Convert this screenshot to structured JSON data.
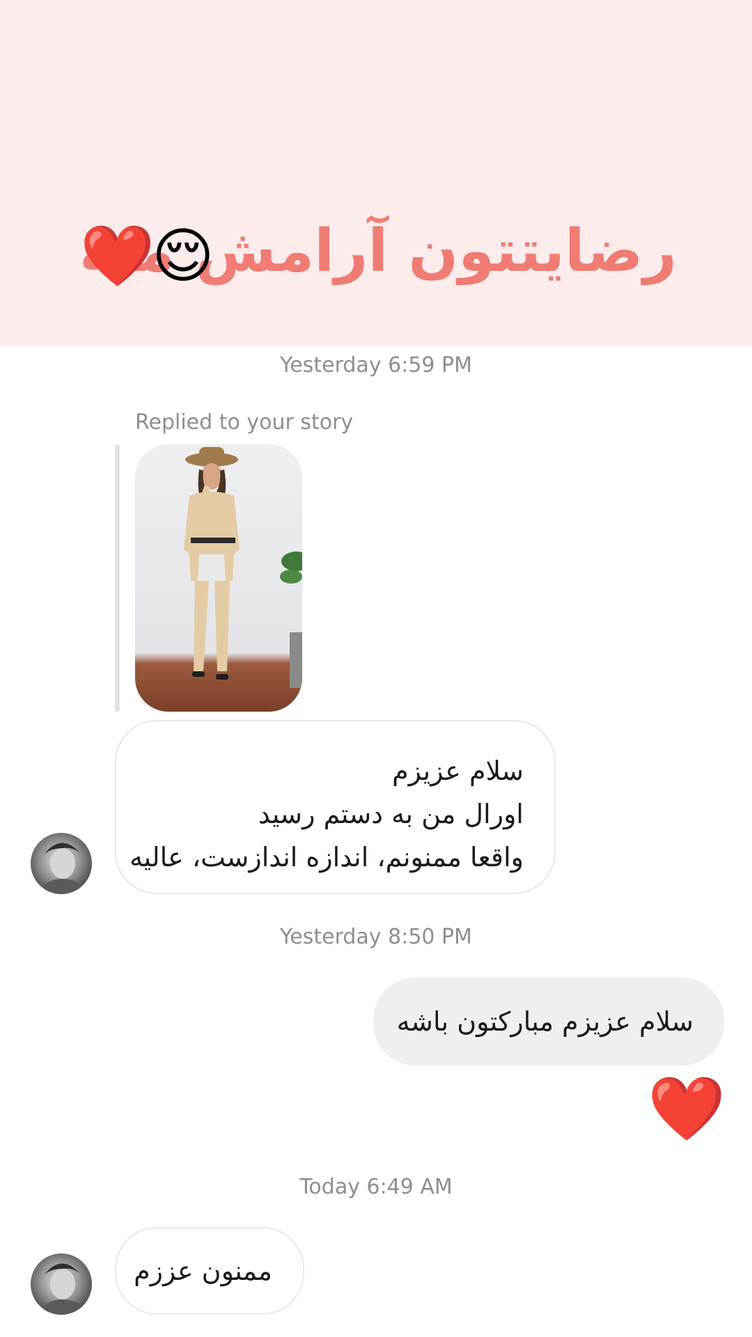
{
  "story_banner": {
    "text": "رضایتتون آرامش منه",
    "emojis": [
      "😌",
      "❤️"
    ],
    "background_color": "#fdecec",
    "text_color": "#f07c73"
  },
  "timestamps": [
    "Yesterday 6:59 PM",
    "Yesterday 8:50 PM",
    "Today 6:49 AM"
  ],
  "story_reply": {
    "caption": "Replied to your story"
  },
  "messages": [
    {
      "sender": "other",
      "lines": [
        "سلام عزیزم",
        "اورال من به دستم رسید",
        "واقعا ممنونم، اندازه اندازست، عالیه"
      ]
    },
    {
      "sender": "me",
      "text": "سلام عزیزم مبارکتون باشه"
    },
    {
      "sender": "me",
      "reaction": "❤️"
    },
    {
      "sender": "other",
      "text": "ممنون عززم"
    }
  ]
}
